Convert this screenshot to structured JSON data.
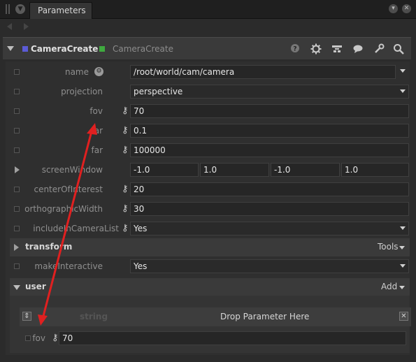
{
  "tab": {
    "title": "Parameters"
  },
  "node": {
    "name": "CameraCreate",
    "type": "CameraCreate"
  },
  "icons": {
    "help": "help-icon",
    "settings": "gear-icon",
    "layout": "layout-icon",
    "comment": "speech-bubble-icon",
    "tool": "wrench-icon",
    "search": "magnifier-icon",
    "locked": "key-icon"
  },
  "colors": {
    "node_swatch_left": "#5b5bd6",
    "node_swatch_right": "#3faa3f",
    "annotation_arrow": "#e02020"
  },
  "params": {
    "name": {
      "label": "name",
      "value": "/root/world/cam/camera"
    },
    "projection": {
      "label": "projection",
      "value": "perspective"
    },
    "fov": {
      "label": "fov",
      "value": "70"
    },
    "near": {
      "label": "ear",
      "value": "0.1"
    },
    "far": {
      "label": "far",
      "value": "100000"
    },
    "screenWindow": {
      "label": "screenWindow",
      "values": [
        "-1.0",
        "1.0",
        "-1.0",
        "1.0"
      ]
    },
    "centerOfInterest": {
      "label": "centerOfInterest",
      "value": "20"
    },
    "orthographicWidth": {
      "label": "orthographicWidth",
      "value": "30"
    },
    "includeInCameraList": {
      "label": "includeInCameraList",
      "value": "Yes"
    },
    "makeInteractive": {
      "label": "makeInteractive",
      "value": "Yes"
    }
  },
  "groups": {
    "transform": {
      "title": "transform",
      "button": "Tools"
    },
    "user": {
      "title": "user",
      "button": "Add"
    }
  },
  "drop_zone": {
    "type_label": "string",
    "text": "Drop Parameter Here"
  },
  "user_param": {
    "label": "fov",
    "value": "70"
  }
}
